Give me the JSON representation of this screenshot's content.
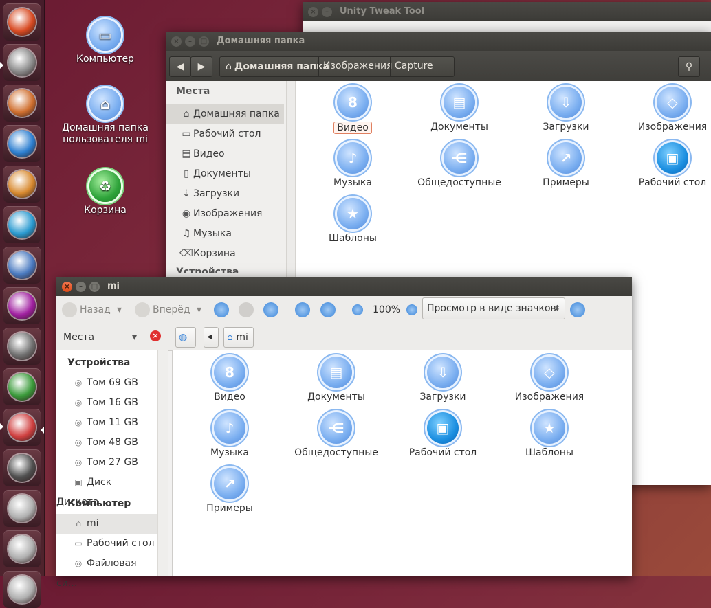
{
  "launcher": {
    "items": [
      {
        "name": "ubuntu-dash",
        "color": "#d84a22"
      },
      {
        "name": "files",
        "color": "#8a8a8a"
      },
      {
        "name": "app-2",
        "color": "#d07030"
      },
      {
        "name": "software-center",
        "color": "#2d7fd0"
      },
      {
        "name": "app-4",
        "color": "#d88a30"
      },
      {
        "name": "app-5",
        "color": "#2a9ad0"
      },
      {
        "name": "app-6",
        "color": "#4a7ac0"
      },
      {
        "name": "app-7",
        "color": "#a020a0"
      },
      {
        "name": "settings",
        "color": "#707070"
      },
      {
        "name": "app-9",
        "color": "#3a9a3a"
      },
      {
        "name": "app-10",
        "color": "#d04040"
      },
      {
        "name": "floppy",
        "color": "#505050"
      },
      {
        "name": "disk-1",
        "color": "#b0b0b0"
      },
      {
        "name": "disk-2",
        "color": "#b0b0b0"
      },
      {
        "name": "disk-3",
        "color": "#b0b0b0"
      }
    ]
  },
  "desktop": {
    "icons": [
      {
        "label": "Компьютер",
        "icon": "computer-icon"
      },
      {
        "label": "Домашняя папка пользователя mi",
        "icon": "home-icon"
      },
      {
        "label": "Корзина",
        "icon": "trash-icon"
      }
    ]
  },
  "tweak": {
    "title": "Unity Tweak Tool"
  },
  "home": {
    "title": "Домашняя папка",
    "breadcrumbs": [
      "Домашняя папка",
      "Изображения",
      "Capture"
    ],
    "sidebar_title": "Места",
    "sidebar": [
      {
        "label": "Домашняя папка",
        "icon": "⌂"
      },
      {
        "label": "Рабочий стол",
        "icon": "▭"
      },
      {
        "label": "Видео",
        "icon": "▤"
      },
      {
        "label": "Документы",
        "icon": "▯"
      },
      {
        "label": "Загрузки",
        "icon": "⇣"
      },
      {
        "label": "Изображения",
        "icon": "◉"
      },
      {
        "label": "Музыка",
        "icon": "♫"
      },
      {
        "label": "Корзина",
        "icon": "⌫"
      }
    ],
    "sidebar_partial": "Устройства",
    "files": [
      {
        "label": "Видео",
        "glyph": "8"
      },
      {
        "label": "Документы",
        "glyph": "▤"
      },
      {
        "label": "Загрузки",
        "glyph": "⇩"
      },
      {
        "label": "Изображения",
        "glyph": "◇"
      },
      {
        "label": "Музыка",
        "glyph": "♪"
      },
      {
        "label": "Общедоступные",
        "glyph": "⋲"
      },
      {
        "label": "Примеры",
        "glyph": "↗"
      },
      {
        "label": "Рабочий стол",
        "glyph": "▣"
      },
      {
        "label": "Шаблоны",
        "glyph": "★"
      }
    ]
  },
  "mi": {
    "title": "mi",
    "back": "Назад",
    "forward": "Вперёд",
    "zoom": "100%",
    "view_mode": "Просмотр в виде значков",
    "places_label": "Места",
    "path": "mi",
    "sections": [
      {
        "title": "Устройства",
        "items": [
          {
            "label": "Том 69 GB",
            "icon": "◎"
          },
          {
            "label": "Том 16 GB",
            "icon": "◎"
          },
          {
            "label": "Том 11 GB",
            "icon": "◎"
          },
          {
            "label": "Том 48 GB",
            "icon": "◎"
          },
          {
            "label": "Том 27 GB",
            "icon": "◎"
          },
          {
            "label": "Диск Дискета",
            "icon": "▣"
          }
        ]
      },
      {
        "title": "Компьютер",
        "items": [
          {
            "label": "mi",
            "icon": "⌂"
          },
          {
            "label": "Рабочий стол",
            "icon": "▭"
          },
          {
            "label": "Файловая си...",
            "icon": "◎"
          }
        ]
      }
    ],
    "files": [
      {
        "label": "Видео",
        "glyph": "8"
      },
      {
        "label": "Документы",
        "glyph": "▤"
      },
      {
        "label": "Загрузки",
        "glyph": "⇩"
      },
      {
        "label": "Изображения",
        "glyph": "◇"
      },
      {
        "label": "Музыка",
        "glyph": "♪"
      },
      {
        "label": "Общедоступные",
        "glyph": "⋲"
      },
      {
        "label": "Рабочий стол",
        "glyph": "▣"
      },
      {
        "label": "Шаблоны",
        "glyph": "★"
      },
      {
        "label": "Примеры",
        "glyph": "↗"
      }
    ]
  }
}
